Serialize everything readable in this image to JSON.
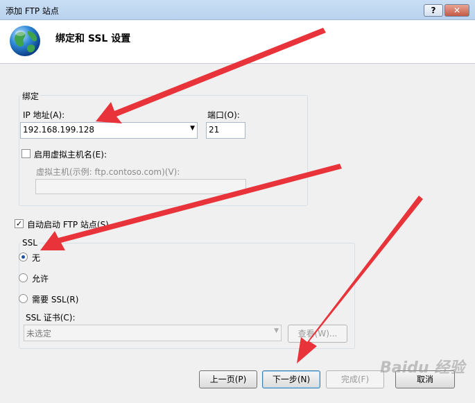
{
  "window": {
    "title": "添加 FTP 站点",
    "help_label": "?",
    "close_label": "✕"
  },
  "header": {
    "heading": "绑定和 SSL 设置",
    "icon": "globe-icon"
  },
  "binding": {
    "legend": "绑定",
    "ip_label": "IP 地址(A):",
    "ip_value": "192.168.199.128",
    "port_label": "端口(O):",
    "port_value": "21",
    "virtual_host_checkbox_label": "启用虚拟主机名(E):",
    "virtual_host_checked": false,
    "virtual_host_label": "虚拟主机(示例: ftp.contoso.com)(V):",
    "virtual_host_value": ""
  },
  "autostart": {
    "label": "自动启动 FTP 站点(S)",
    "checked": true
  },
  "ssl": {
    "legend": "SSL",
    "options": [
      {
        "label": "无",
        "selected": true
      },
      {
        "label": "允许",
        "selected": false
      },
      {
        "label": "需要 SSL(R)",
        "selected": false
      }
    ],
    "cert_label": "SSL 证书(C):",
    "cert_value": "未选定",
    "view_label": "查看(W)..."
  },
  "buttons": {
    "prev": "上一页(P)",
    "next": "下一步(N)",
    "finish": "完成(F)",
    "cancel": "取消"
  },
  "watermark": "Baidu 经验",
  "colors": {
    "arrow": "#e8333a",
    "titlebar": "#c9def4",
    "dialog_bg": "#f0f0f0"
  }
}
